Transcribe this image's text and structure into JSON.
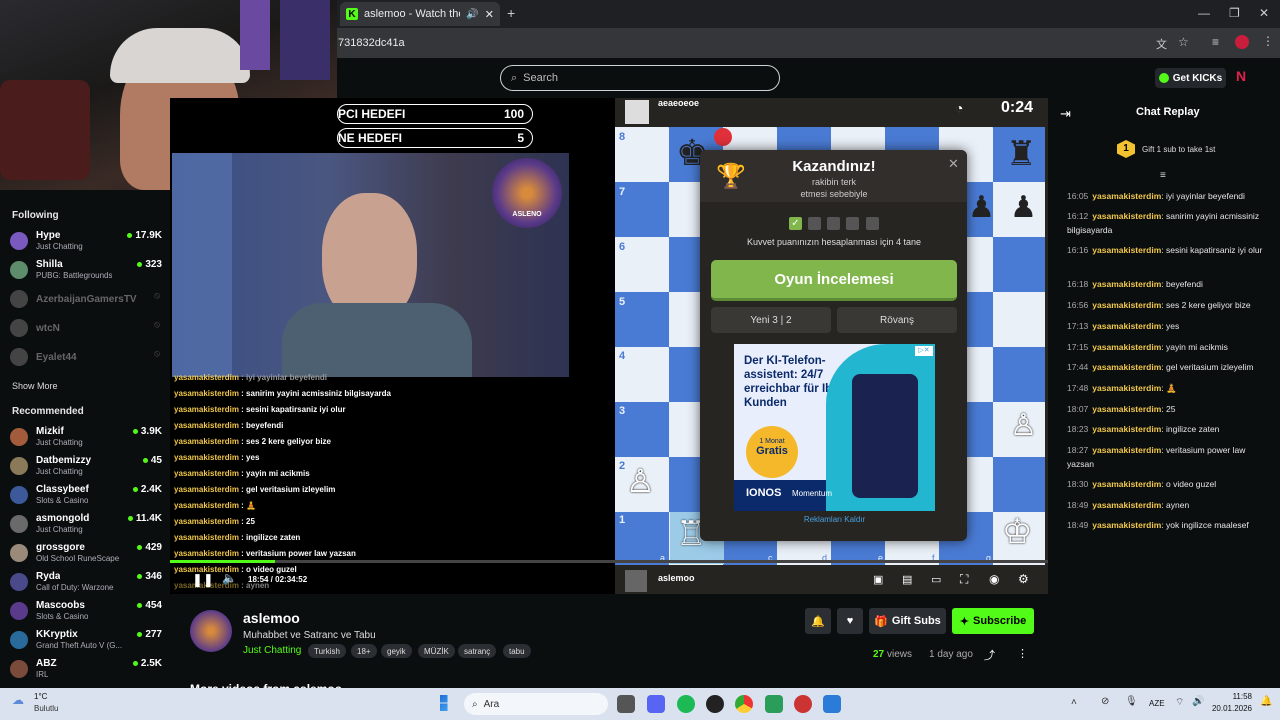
{
  "browser": {
    "tab_title": "aslemoo - Watch the VOD",
    "url": "731832dc41a",
    "new_tab": "+"
  },
  "header": {
    "search_placeholder": "Search",
    "get_kicks": "Get KICKs"
  },
  "sidebar": {
    "following_title": "Following",
    "following": [
      {
        "name": "Hype",
        "category": "Just Chatting",
        "viewers": "17.9K",
        "online": true
      },
      {
        "name": "Shilla",
        "category": "PUBG: Battlegrounds",
        "viewers": "323",
        "online": true
      },
      {
        "name": "AzerbaijanGamersTV",
        "category": "",
        "viewers": "",
        "online": false
      },
      {
        "name": "wtcN",
        "category": "",
        "viewers": "",
        "online": false
      },
      {
        "name": "Eyalet44",
        "category": "",
        "viewers": "",
        "online": false
      }
    ],
    "show_more": "Show More",
    "recommended_title": "Recommended",
    "recommended": [
      {
        "name": "Mizkif",
        "category": "Just Chatting",
        "viewers": "3.9K"
      },
      {
        "name": "Datbemizzy",
        "category": "Just Chatting",
        "viewers": "45"
      },
      {
        "name": "Classybeef",
        "category": "Slots & Casino",
        "viewers": "2.4K"
      },
      {
        "name": "asmongold",
        "category": "Just Chatting",
        "viewers": "11.4K"
      },
      {
        "name": "grossgore",
        "category": "Old School RuneScape",
        "viewers": "429"
      },
      {
        "name": "Ryda",
        "category": "Call of Duty: Warzone",
        "viewers": "346"
      },
      {
        "name": "Mascoobs",
        "category": "Slots & Casino",
        "viewers": "454"
      },
      {
        "name": "KKryptix",
        "category": "Grand Theft Auto V (G...",
        "viewers": "277"
      },
      {
        "name": "ABZ",
        "category": "IRL",
        "viewers": "2.5K"
      }
    ]
  },
  "video": {
    "goal1_label": "PCI HEDEFI",
    "goal1_value": "100",
    "goal2_label": "NE HEDEFI",
    "goal2_value": "5",
    "lion_label": "ASLENO",
    "time": "18:54 / 02:34:52",
    "overlay_chat": [
      {
        "user": "yasamakisterdim",
        "text": "iyi yayinlar beyefendi"
      },
      {
        "user": "yasamakisterdim",
        "text": "sanirim yayini acmissiniz bilgisayarda"
      },
      {
        "user": "yasamakisterdim",
        "text": "sesini kapatirsaniz iyi olur"
      },
      {
        "user": "yasamakisterdim",
        "text": "beyefendi"
      },
      {
        "user": "yasamakisterdim",
        "text": "ses 2 kere geliyor bize"
      },
      {
        "user": "yasamakisterdim",
        "text": "yes"
      },
      {
        "user": "yasamakisterdim",
        "text": "yayin mi acikmis"
      },
      {
        "user": "yasamakisterdim",
        "text": "gel veritasium izleyelim"
      },
      {
        "user": "yasamakisterdim",
        "text": "🧘"
      },
      {
        "user": "yasamakisterdim",
        "text": "25"
      },
      {
        "user": "yasamakisterdim",
        "text": "ingilizce zaten"
      },
      {
        "user": "yasamakisterdim",
        "text": "veritasium power law yazsan"
      },
      {
        "user": "yasamakisterdim",
        "text": "o video guzel"
      },
      {
        "user": "yasamakisterdim",
        "text": "aynen"
      }
    ]
  },
  "chess": {
    "top_player": "aeaeoeoe",
    "clock": "0:24",
    "bottom_player": "aslemoo",
    "ranks": [
      "8",
      "7",
      "6",
      "5",
      "4",
      "3",
      "2",
      "1"
    ],
    "files": [
      "a",
      "b",
      "c",
      "d",
      "e",
      "f",
      "g"
    ],
    "modal": {
      "title": "Kazandınız!",
      "subtitle1": "rakibin terk",
      "subtitle2": "etmesi sebebiyle",
      "strength_text": "Kuvvet puanınızın hesaplanması için 4 tane",
      "review": "Oyun İncelemesi",
      "new_game": "Yeni 3 | 2",
      "rematch": "Rövanş",
      "remove_ads": "Reklamları Kaldır"
    },
    "ad": {
      "headline": "Der KI-Telefon-assistent: 24/7 erreichbar für Ihre Kunden",
      "badge1": "1 Monat",
      "badge2": "Gratis",
      "brand": "IONOS",
      "product": "Momentum"
    }
  },
  "stream": {
    "channel": "aslemoo",
    "title": "Muhabbet ve Satranc ve Tabu",
    "category": "Just Chatting",
    "tags": [
      "Turkish",
      "18+",
      "geyik",
      "MÜZİK",
      "satranç",
      "tabu"
    ],
    "views": "27",
    "views_label": "views",
    "ago": "1 day ago",
    "gift_subs": "Gift Subs",
    "subscribe": "Subscribe",
    "more_videos": "More videos from aslemoo"
  },
  "chat": {
    "title": "Chat Replay",
    "gift_rank": "1",
    "gift_text": "Gift 1 sub to take 1st",
    "messages": [
      {
        "time": "16:05",
        "user": "yasamakisterdim",
        "text": "iyi yayinlar beyefendi"
      },
      {
        "time": "16:12",
        "user": "yasamakisterdim",
        "text": "sanirim yayini acmissiniz bilgisayarda"
      },
      {
        "time": "16:16",
        "user": "yasamakisterdim",
        "text": "sesini kapatirsaniz iyi olur"
      },
      {
        "time": "16:18",
        "user": "yasamakisterdim",
        "text": "beyefendi"
      },
      {
        "time": "16:56",
        "user": "yasamakisterdim",
        "text": "ses 2 kere geliyor bize"
      },
      {
        "time": "17:13",
        "user": "yasamakisterdim",
        "text": "yes"
      },
      {
        "time": "17:15",
        "user": "yasamakisterdim",
        "text": "yayin mi acikmis"
      },
      {
        "time": "17:44",
        "user": "yasamakisterdim",
        "text": "gel veritasium izleyelim"
      },
      {
        "time": "17:48",
        "user": "yasamakisterdim",
        "text": "🧘"
      },
      {
        "time": "18:07",
        "user": "yasamakisterdim",
        "text": "25"
      },
      {
        "time": "18:23",
        "user": "yasamakisterdim",
        "text": "ingilizce zaten"
      },
      {
        "time": "18:27",
        "user": "yasamakisterdim",
        "text": "veritasium power law yazsan"
      },
      {
        "time": "18:30",
        "user": "yasamakisterdim",
        "text": "o video guzel"
      },
      {
        "time": "18:49",
        "user": "yasamakisterdim",
        "text": "aynen"
      },
      {
        "time": "18:49",
        "user": "yasamakisterdim",
        "text": "yok ingilizce maalesef"
      }
    ]
  },
  "taskbar": {
    "weather_temp": "1°C",
    "weather_desc": "Bulutlu",
    "search": "Ara",
    "lang": "AZE",
    "time": "11:58",
    "date": "20.01.2026"
  },
  "colors": {
    "kick_green": "#53fc18",
    "chess_green": "#81b64c",
    "chat_user": "#f2c84b"
  }
}
